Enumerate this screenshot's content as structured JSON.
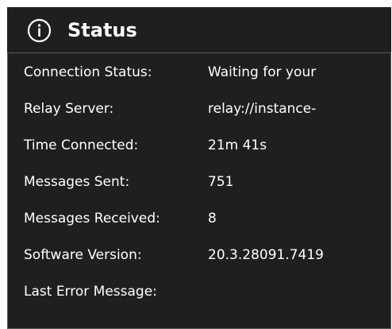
{
  "panel": {
    "title": "Status",
    "icon": "info-circle-icon"
  },
  "rows": [
    {
      "label": "Connection Status:",
      "value": "Waiting for your"
    },
    {
      "label": "Relay Server:",
      "value": "relay://instance-"
    },
    {
      "label": "Time Connected:",
      "value": "21m 41s"
    },
    {
      "label": "Messages Sent:",
      "value": "751"
    },
    {
      "label": "Messages Received:",
      "value": "8"
    },
    {
      "label": "Software Version:",
      "value": "20.3.28091.7419"
    },
    {
      "label": "Last Error Message:",
      "value": ""
    }
  ],
  "colors": {
    "background": "#1f1f1f",
    "text": "#ffffff",
    "border": "#5a5a5a"
  }
}
